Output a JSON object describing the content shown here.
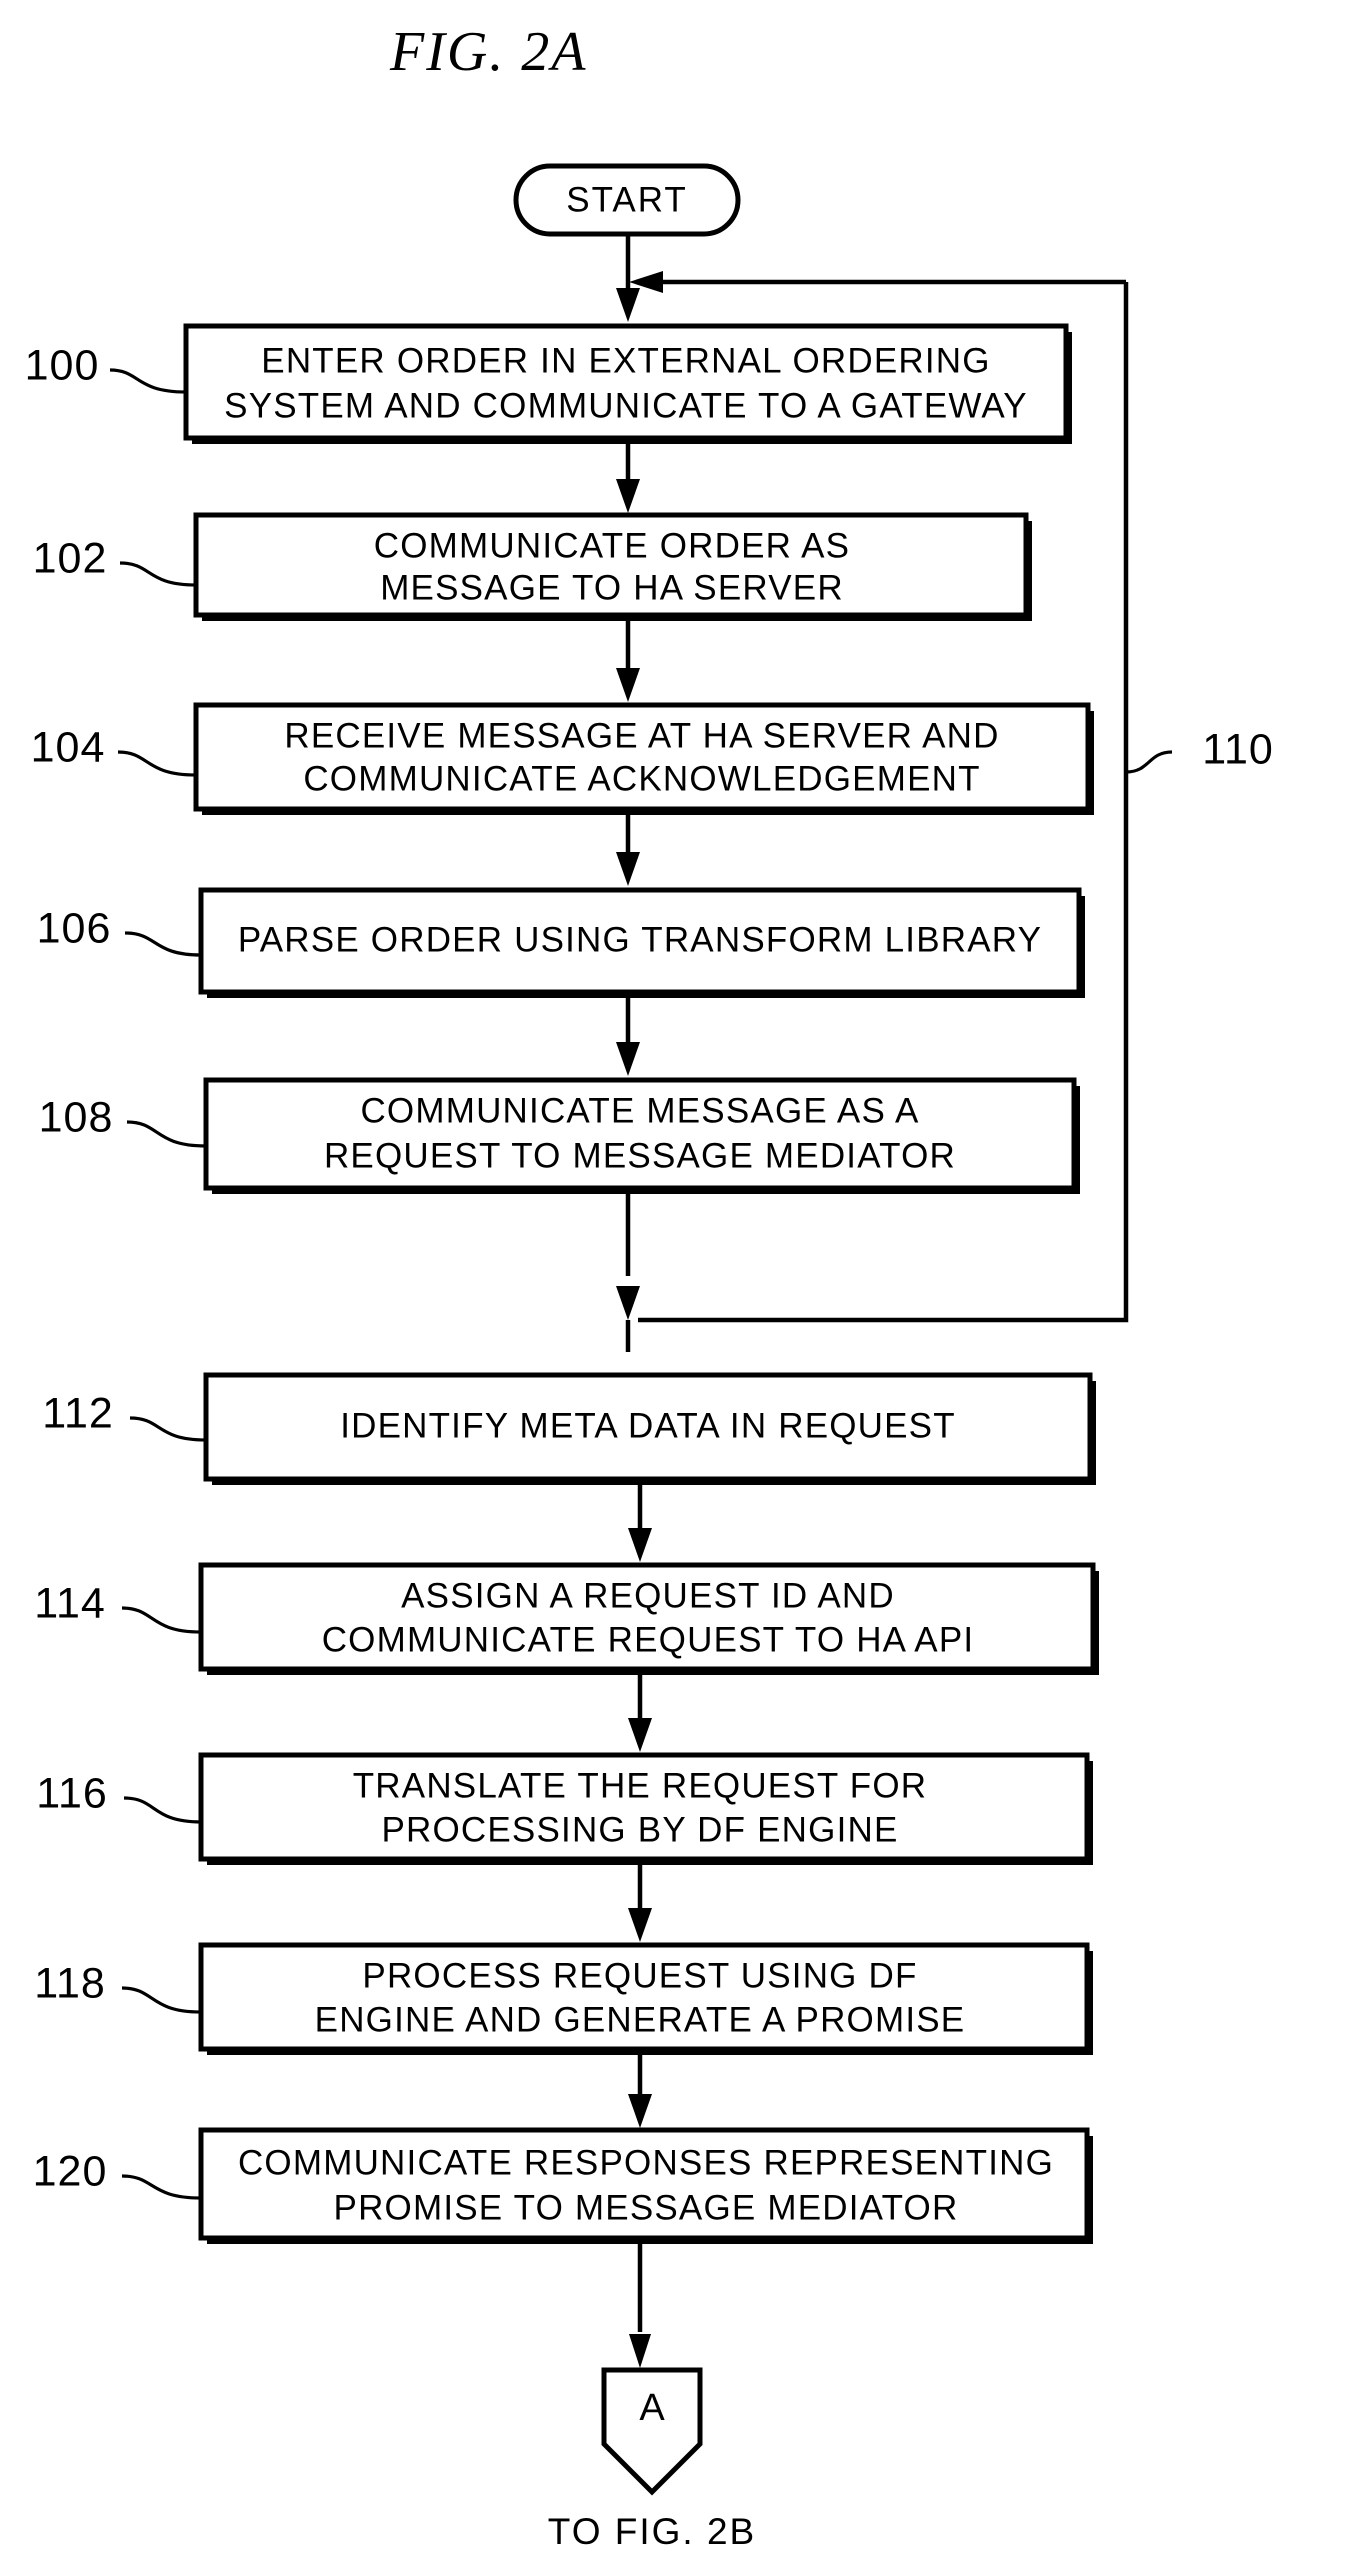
{
  "figure": {
    "title": "FIG. 2A",
    "start_label": "START",
    "connector_letter": "A",
    "caption": "TO FIG. 2B",
    "loop_ref": "110",
    "ink_color": "#000000",
    "paper_color": "#ffffff"
  },
  "steps": [
    {
      "ref": "100",
      "lines": [
        "ENTER ORDER IN EXTERNAL ORDERING",
        "SYSTEM AND COMMUNICATE TO A GATEWAY"
      ]
    },
    {
      "ref": "102",
      "lines": [
        "COMMUNICATE ORDER AS",
        "MESSAGE TO HA SERVER"
      ]
    },
    {
      "ref": "104",
      "lines": [
        "RECEIVE MESSAGE AT HA SERVER AND",
        "COMMUNICATE ACKNOWLEDGEMENT"
      ]
    },
    {
      "ref": "106",
      "lines": [
        "PARSE ORDER USING TRANSFORM LIBRARY"
      ]
    },
    {
      "ref": "108",
      "lines": [
        "COMMUNICATE MESSAGE AS A",
        "REQUEST TO MESSAGE MEDIATOR"
      ]
    },
    {
      "ref": "112",
      "lines": [
        "IDENTIFY META DATA IN REQUEST"
      ]
    },
    {
      "ref": "114",
      "lines": [
        "ASSIGN A REQUEST ID AND",
        "COMMUNICATE REQUEST TO HA API"
      ]
    },
    {
      "ref": "116",
      "lines": [
        "TRANSLATE THE REQUEST FOR",
        "PROCESSING BY DF ENGINE"
      ]
    },
    {
      "ref": "118",
      "lines": [
        "PROCESS REQUEST USING DF",
        "ENGINE AND GENERATE A PROMISE"
      ]
    },
    {
      "ref": "120",
      "lines": [
        "COMMUNICATE RESPONSES REPRESENTING",
        "PROMISE TO MESSAGE MEDIATOR"
      ]
    }
  ]
}
